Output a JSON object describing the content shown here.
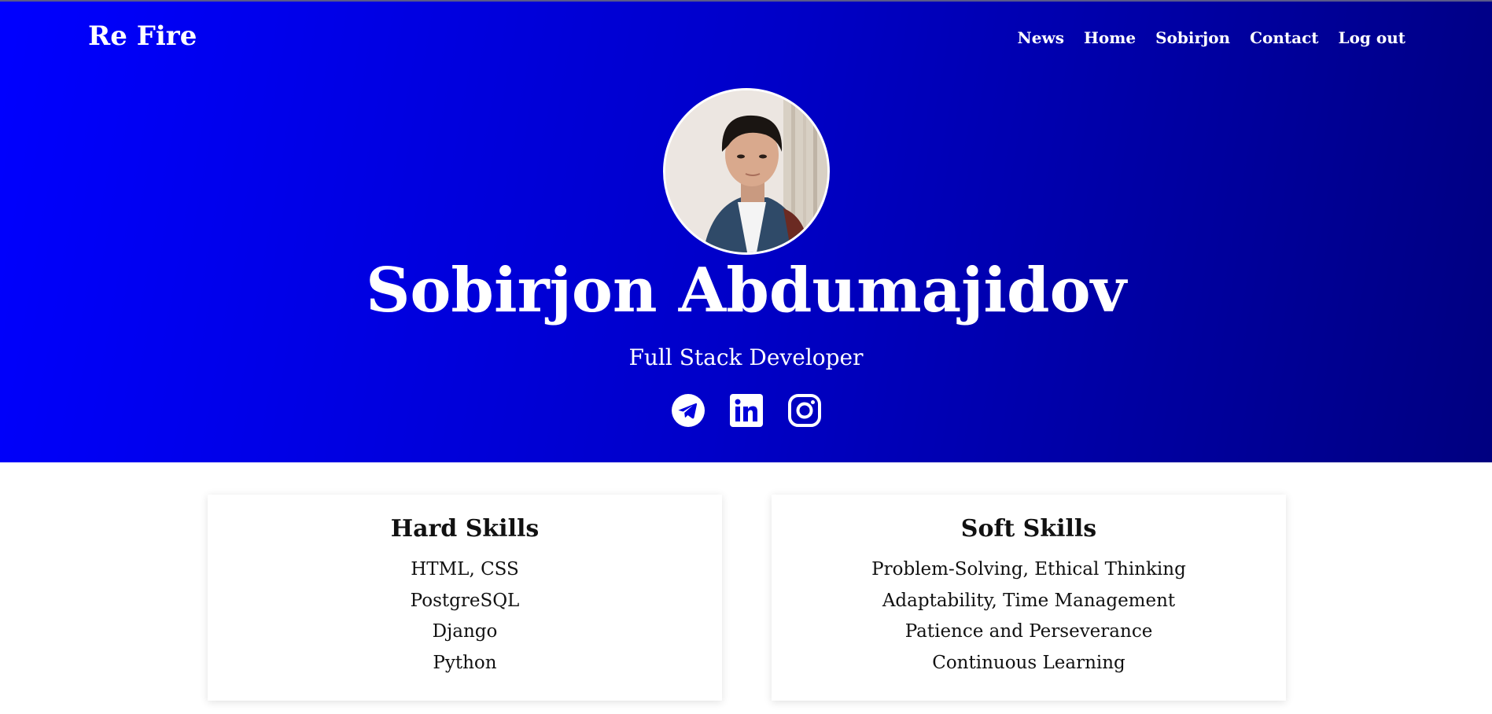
{
  "header": {
    "brand": "Re Fire",
    "nav": [
      {
        "label": "News"
      },
      {
        "label": "Home"
      },
      {
        "label": "Sobirjon"
      },
      {
        "label": "Contact"
      },
      {
        "label": "Log out"
      }
    ]
  },
  "profile": {
    "name": "Sobirjon Abdumajidov",
    "role": "Full Stack Developer",
    "socials": [
      {
        "icon": "telegram-icon"
      },
      {
        "icon": "linkedin-icon"
      },
      {
        "icon": "instagram-icon"
      }
    ]
  },
  "skills": {
    "hard": {
      "title": "Hard Skills",
      "items": [
        "HTML, CSS",
        "PostgreSQL",
        "Django",
        "Python"
      ]
    },
    "soft": {
      "title": "Soft Skills",
      "items": [
        "Problem-Solving, Ethical Thinking",
        "Adaptability, Time Management",
        "Patience and Perseverance",
        "Continuous Learning"
      ]
    }
  },
  "colors": {
    "hero_gradient_start": "#0000ff",
    "hero_gradient_end": "#000080",
    "text_light": "#ffffff",
    "text_dark": "#111111"
  }
}
